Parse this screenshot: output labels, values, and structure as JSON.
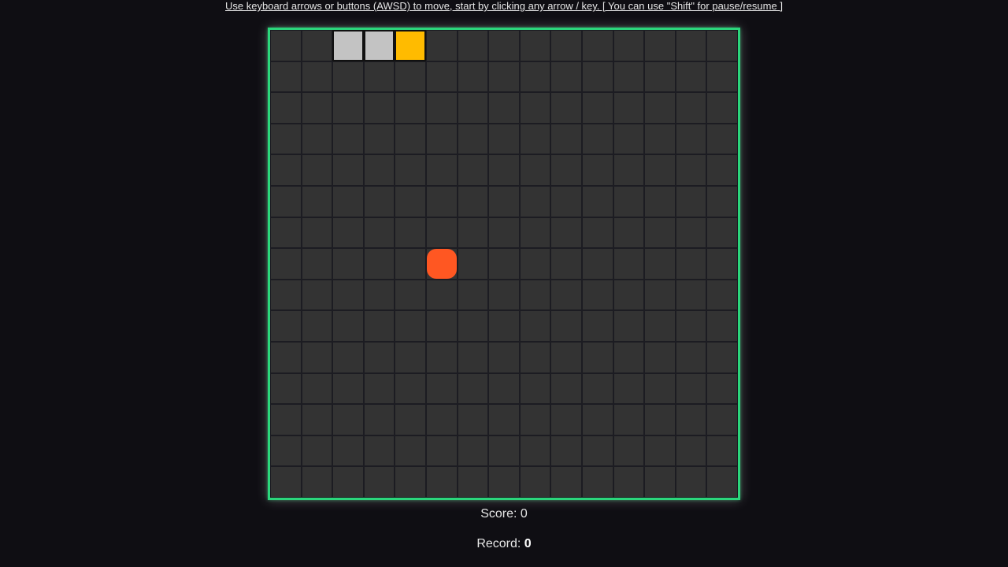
{
  "instructions": "Use keyboard arrows or buttons (AWSD) to move, start by clicking any arrow / key. [ You can use \"Shift\" for pause/resume ]",
  "board": {
    "rows": 15,
    "cols": 15,
    "snake_body": [
      [
        0,
        2
      ],
      [
        0,
        3
      ]
    ],
    "snake_head": [
      0,
      4
    ],
    "food": [
      7,
      5
    ]
  },
  "score": {
    "label": "Score: ",
    "value": "0"
  },
  "record": {
    "label": "Record: ",
    "value": "0"
  },
  "colors": {
    "border": "#2bd67b",
    "cell": "#333333",
    "snake": "#c3c3c3",
    "head": "#ffbb00",
    "food": "#ff5722",
    "background": "#0f0e13"
  }
}
